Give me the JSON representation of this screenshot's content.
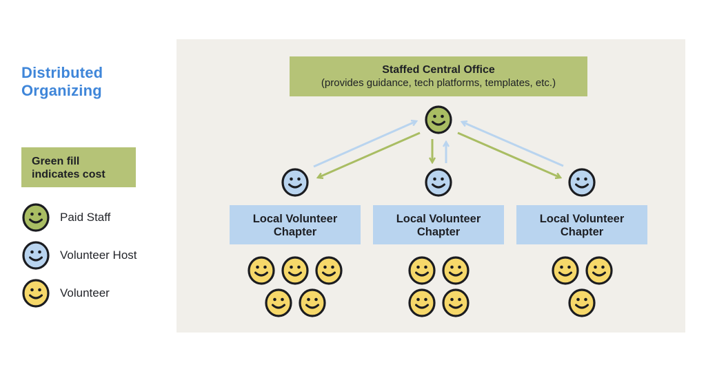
{
  "title": {
    "line1": "Distributed",
    "line2": "Organizing"
  },
  "colors": {
    "paid_staff": "#a9bd63",
    "volunteer_host": "#b9d4ef",
    "volunteer": "#f6d86a",
    "title_blue": "#3f86d9",
    "cost_fill": "#b5c377"
  },
  "legend": {
    "note_line1": "Green fill",
    "note_line2": "indicates cost",
    "items": [
      {
        "label": "Paid Staff",
        "icon": "paid-staff-face-icon"
      },
      {
        "label": "Volunteer Host",
        "icon": "volunteer-host-face-icon"
      },
      {
        "label": "Volunteer",
        "icon": "volunteer-face-icon"
      }
    ]
  },
  "central_office": {
    "title": "Staffed Central Office",
    "subtitle": "(provides guidance, tech platforms, templates, etc.)"
  },
  "chapters": [
    {
      "line1": "Local Volunteer",
      "line2": "Chapter",
      "volunteer_count": 5
    },
    {
      "line1": "Local Volunteer",
      "line2": "Chapter",
      "volunteer_count": 4
    },
    {
      "line1": "Local Volunteer",
      "line2": "Chapter",
      "volunteer_count": 3
    }
  ]
}
